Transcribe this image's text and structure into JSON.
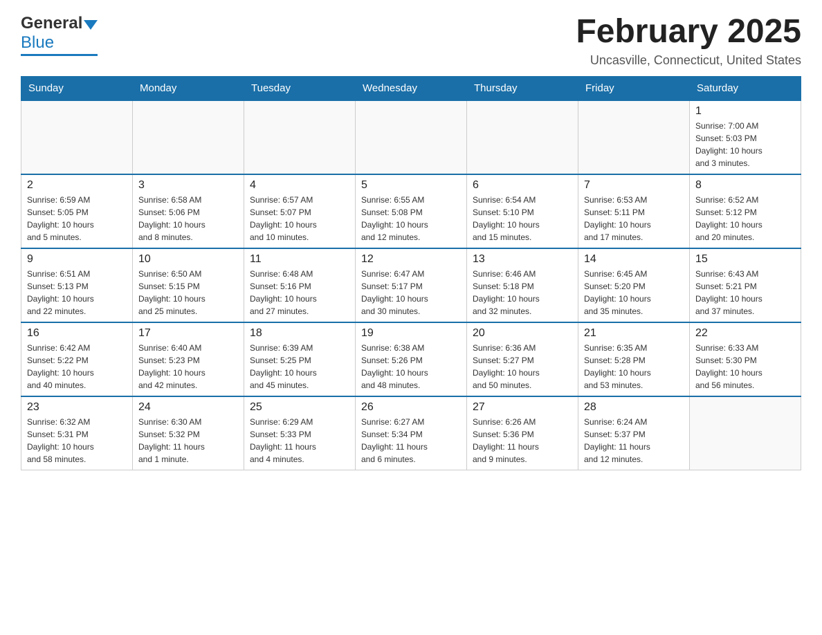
{
  "header": {
    "logo_general": "General",
    "logo_blue": "Blue",
    "title": "February 2025",
    "subtitle": "Uncasville, Connecticut, United States"
  },
  "days_of_week": [
    "Sunday",
    "Monday",
    "Tuesday",
    "Wednesday",
    "Thursday",
    "Friday",
    "Saturday"
  ],
  "weeks": [
    [
      {
        "day": "",
        "info": ""
      },
      {
        "day": "",
        "info": ""
      },
      {
        "day": "",
        "info": ""
      },
      {
        "day": "",
        "info": ""
      },
      {
        "day": "",
        "info": ""
      },
      {
        "day": "",
        "info": ""
      },
      {
        "day": "1",
        "info": "Sunrise: 7:00 AM\nSunset: 5:03 PM\nDaylight: 10 hours\nand 3 minutes."
      }
    ],
    [
      {
        "day": "2",
        "info": "Sunrise: 6:59 AM\nSunset: 5:05 PM\nDaylight: 10 hours\nand 5 minutes."
      },
      {
        "day": "3",
        "info": "Sunrise: 6:58 AM\nSunset: 5:06 PM\nDaylight: 10 hours\nand 8 minutes."
      },
      {
        "day": "4",
        "info": "Sunrise: 6:57 AM\nSunset: 5:07 PM\nDaylight: 10 hours\nand 10 minutes."
      },
      {
        "day": "5",
        "info": "Sunrise: 6:55 AM\nSunset: 5:08 PM\nDaylight: 10 hours\nand 12 minutes."
      },
      {
        "day": "6",
        "info": "Sunrise: 6:54 AM\nSunset: 5:10 PM\nDaylight: 10 hours\nand 15 minutes."
      },
      {
        "day": "7",
        "info": "Sunrise: 6:53 AM\nSunset: 5:11 PM\nDaylight: 10 hours\nand 17 minutes."
      },
      {
        "day": "8",
        "info": "Sunrise: 6:52 AM\nSunset: 5:12 PM\nDaylight: 10 hours\nand 20 minutes."
      }
    ],
    [
      {
        "day": "9",
        "info": "Sunrise: 6:51 AM\nSunset: 5:13 PM\nDaylight: 10 hours\nand 22 minutes."
      },
      {
        "day": "10",
        "info": "Sunrise: 6:50 AM\nSunset: 5:15 PM\nDaylight: 10 hours\nand 25 minutes."
      },
      {
        "day": "11",
        "info": "Sunrise: 6:48 AM\nSunset: 5:16 PM\nDaylight: 10 hours\nand 27 minutes."
      },
      {
        "day": "12",
        "info": "Sunrise: 6:47 AM\nSunset: 5:17 PM\nDaylight: 10 hours\nand 30 minutes."
      },
      {
        "day": "13",
        "info": "Sunrise: 6:46 AM\nSunset: 5:18 PM\nDaylight: 10 hours\nand 32 minutes."
      },
      {
        "day": "14",
        "info": "Sunrise: 6:45 AM\nSunset: 5:20 PM\nDaylight: 10 hours\nand 35 minutes."
      },
      {
        "day": "15",
        "info": "Sunrise: 6:43 AM\nSunset: 5:21 PM\nDaylight: 10 hours\nand 37 minutes."
      }
    ],
    [
      {
        "day": "16",
        "info": "Sunrise: 6:42 AM\nSunset: 5:22 PM\nDaylight: 10 hours\nand 40 minutes."
      },
      {
        "day": "17",
        "info": "Sunrise: 6:40 AM\nSunset: 5:23 PM\nDaylight: 10 hours\nand 42 minutes."
      },
      {
        "day": "18",
        "info": "Sunrise: 6:39 AM\nSunset: 5:25 PM\nDaylight: 10 hours\nand 45 minutes."
      },
      {
        "day": "19",
        "info": "Sunrise: 6:38 AM\nSunset: 5:26 PM\nDaylight: 10 hours\nand 48 minutes."
      },
      {
        "day": "20",
        "info": "Sunrise: 6:36 AM\nSunset: 5:27 PM\nDaylight: 10 hours\nand 50 minutes."
      },
      {
        "day": "21",
        "info": "Sunrise: 6:35 AM\nSunset: 5:28 PM\nDaylight: 10 hours\nand 53 minutes."
      },
      {
        "day": "22",
        "info": "Sunrise: 6:33 AM\nSunset: 5:30 PM\nDaylight: 10 hours\nand 56 minutes."
      }
    ],
    [
      {
        "day": "23",
        "info": "Sunrise: 6:32 AM\nSunset: 5:31 PM\nDaylight: 10 hours\nand 58 minutes."
      },
      {
        "day": "24",
        "info": "Sunrise: 6:30 AM\nSunset: 5:32 PM\nDaylight: 11 hours\nand 1 minute."
      },
      {
        "day": "25",
        "info": "Sunrise: 6:29 AM\nSunset: 5:33 PM\nDaylight: 11 hours\nand 4 minutes."
      },
      {
        "day": "26",
        "info": "Sunrise: 6:27 AM\nSunset: 5:34 PM\nDaylight: 11 hours\nand 6 minutes."
      },
      {
        "day": "27",
        "info": "Sunrise: 6:26 AM\nSunset: 5:36 PM\nDaylight: 11 hours\nand 9 minutes."
      },
      {
        "day": "28",
        "info": "Sunrise: 6:24 AM\nSunset: 5:37 PM\nDaylight: 11 hours\nand 12 minutes."
      },
      {
        "day": "",
        "info": ""
      }
    ]
  ]
}
